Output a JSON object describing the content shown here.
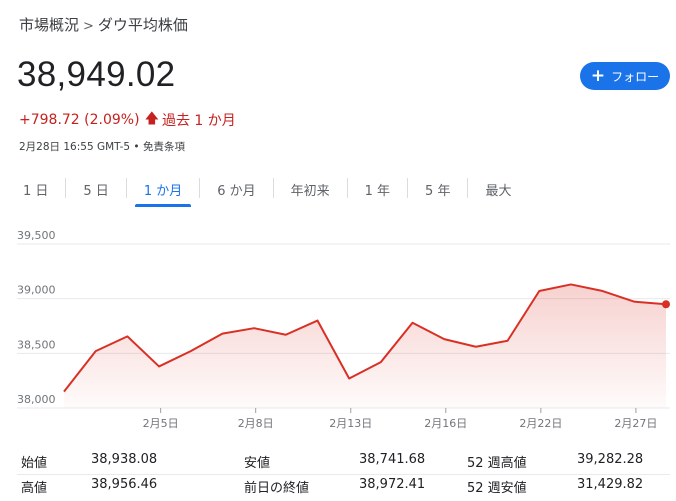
{
  "breadcrumb": {
    "parent": "市場概況",
    "separator": ">",
    "current": "ダウ平均株価"
  },
  "price": {
    "value": "38,949.02"
  },
  "change": {
    "text": "+798.72 (2.09%)",
    "arrow": "🡅",
    "period": "過去 1 か月"
  },
  "meta": {
    "text": "2月28日 16:55 GMT-5 • 免責条項"
  },
  "follow": {
    "plus": "+",
    "label": "フォロー"
  },
  "tabs": [
    {
      "label": "1 日",
      "active": false
    },
    {
      "label": "5 日",
      "active": false
    },
    {
      "label": "1 か月",
      "active": true
    },
    {
      "label": "6 か月",
      "active": false
    },
    {
      "label": "年初来",
      "active": false
    },
    {
      "label": "1 年",
      "active": false
    },
    {
      "label": "5 年",
      "active": false
    },
    {
      "label": "最大",
      "active": false
    }
  ],
  "colors": {
    "line": "#d93025",
    "accent": "#1a73e8",
    "grid": "#e8eaed"
  },
  "chart_data": {
    "type": "area",
    "x": [
      "2/1",
      "2/2",
      "2/5",
      "2/6",
      "2/7",
      "2/8",
      "2/9",
      "2/12",
      "2/13",
      "2/14",
      "2/15",
      "2/16",
      "2/20",
      "2/21",
      "2/22",
      "2/23",
      "2/26",
      "2/27",
      "2/28"
    ],
    "values": [
      38150,
      38520,
      38655,
      38380,
      38520,
      38680,
      38730,
      38670,
      38800,
      38270,
      38420,
      38780,
      38630,
      38560,
      38615,
      39070,
      39130,
      39070,
      38972.41,
      38949.02
    ],
    "x_index_for_values": "evenly spaced",
    "ylim": [
      38000,
      39500
    ],
    "yticks": [
      "39,500",
      "39,000",
      "38,500",
      "38,000"
    ],
    "ytick_values": [
      39500,
      39000,
      38500,
      38000
    ],
    "xticks": [
      "2月5日",
      "2月8日",
      "2月13日",
      "2月16日",
      "2月22日",
      "2月27日"
    ],
    "xtick_positions": [
      3,
      6,
      9,
      12,
      15,
      18
    ],
    "grid": true
  },
  "stats": {
    "row1": [
      "始値",
      "38,938.08",
      "安値",
      "38,741.68",
      "52 週高値",
      "39,282.28"
    ],
    "row2": [
      "高値",
      "38,956.46",
      "前日の終値",
      "38,972.41",
      "52 週安値",
      "31,429.82"
    ]
  }
}
